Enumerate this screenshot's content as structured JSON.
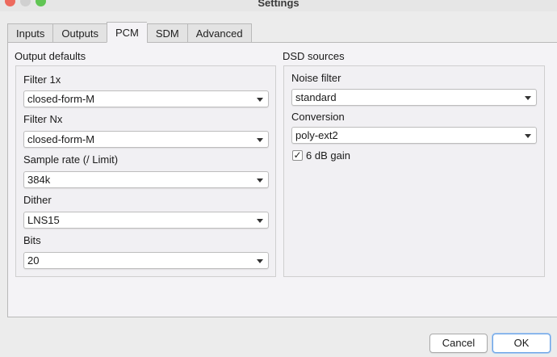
{
  "window": {
    "title": "Settings"
  },
  "tabs": [
    {
      "label": "Inputs"
    },
    {
      "label": "Outputs"
    },
    {
      "label": "PCM"
    },
    {
      "label": "SDM"
    },
    {
      "label": "Advanced"
    }
  ],
  "output_defaults": {
    "title": "Output defaults",
    "filter_1x": {
      "label": "Filter 1x",
      "value": "closed-form-M"
    },
    "filter_nx": {
      "label": "Filter Nx",
      "value": "closed-form-M"
    },
    "sample_rate": {
      "label": "Sample rate (/ Limit)",
      "value": "384k"
    },
    "dither": {
      "label": "Dither",
      "value": "LNS15"
    },
    "bits": {
      "label": "Bits",
      "value": "20"
    }
  },
  "dsd_sources": {
    "title": "DSD sources",
    "noise_filter": {
      "label": "Noise filter",
      "value": "standard"
    },
    "conversion": {
      "label": "Conversion",
      "value": "poly-ext2"
    },
    "gain": {
      "label": "6 dB gain",
      "checked": true,
      "check_glyph": "✓"
    }
  },
  "buttons": {
    "cancel": "Cancel",
    "ok": "OK"
  }
}
